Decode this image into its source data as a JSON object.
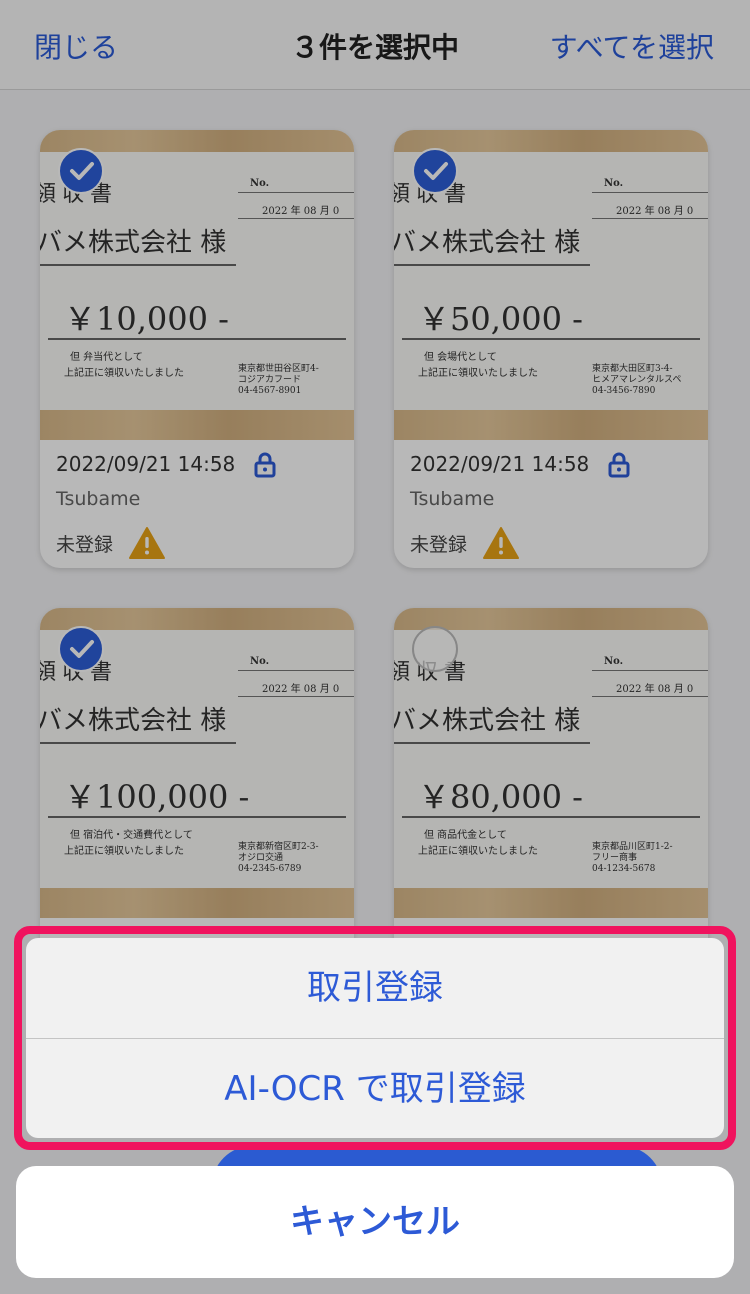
{
  "header": {
    "close_label": "閉じる",
    "title": "３件を選択中",
    "select_all_label": "すべてを選択"
  },
  "cards": [
    {
      "selected": true,
      "receipt": {
        "title": "領収書",
        "no_label": "No.",
        "date": "2022 年 08 月 0",
        "company": "バメ株式会社 様",
        "amount": "￥10,000 -",
        "purpose": "但  弁当代として",
        "note": "上記正に領収いたしました",
        "address": [
          "東京都世田谷区町4-",
          "コジアカフード",
          "04-4567-8901"
        ]
      },
      "datetime": "2022/09/21 14:58",
      "user": "Tsubame",
      "status": "未登録"
    },
    {
      "selected": true,
      "receipt": {
        "title": "領収書",
        "no_label": "No.",
        "date": "2022 年 08 月 0",
        "company": "バメ株式会社 様",
        "amount": "￥50,000 -",
        "purpose": "但  会場代として",
        "note": "上記正に領収いたしました",
        "address": [
          "東京都大田区町3-4-",
          "ヒメアマレンタルスペ",
          "04-3456-7890"
        ]
      },
      "datetime": "2022/09/21 14:58",
      "user": "Tsubame",
      "status": "未登録"
    },
    {
      "selected": true,
      "receipt": {
        "title": "領収書",
        "no_label": "No.",
        "date": "2022 年 08 月 0",
        "company": "バメ株式会社 様",
        "amount": "￥100,000 -",
        "purpose": "但  宿泊代・交通費代として",
        "note": "上記正に領収いたしました",
        "address": [
          "東京都新宿区町2-3-",
          "オジロ交通",
          "04-2345-6789"
        ]
      },
      "datetime": "",
      "user": "",
      "status": ""
    },
    {
      "selected": false,
      "receipt": {
        "title": "領収書",
        "no_label": "No.",
        "date": "2022 年 08 月 0",
        "company": "バメ株式会社 様",
        "amount": "￥80,000 -",
        "purpose": "但  商品代金として",
        "note": "上記正に領収いたしました",
        "address": [
          "東京都品川区町1-2-",
          "フリー商事",
          "04-1234-5678"
        ]
      },
      "datetime": "",
      "user": "",
      "status": ""
    }
  ],
  "action_sheet": {
    "items": [
      "取引登録",
      "AI-OCR で取引登録"
    ],
    "cancel_label": "キャンセル"
  },
  "colors": {
    "accent": "#2d5ad6",
    "highlight": "#f0135e",
    "warning": "#e8a317"
  }
}
